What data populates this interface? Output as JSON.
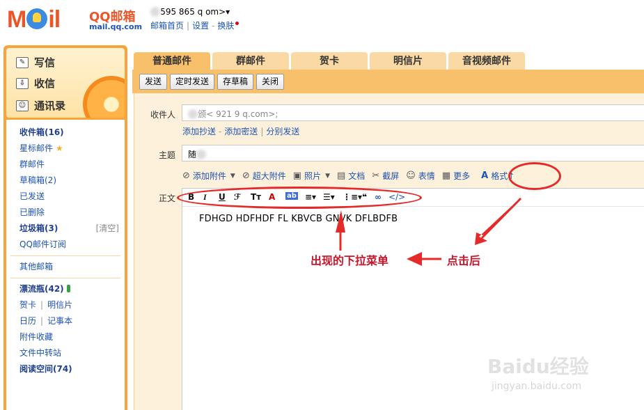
{
  "header": {
    "logo_main": "M  il",
    "logo_qq": "QQ邮箱",
    "logo_url": "mail.qq.com",
    "account": "595  865  q  om>▾",
    "nav": [
      "邮箱首页",
      "设置",
      "换肤"
    ]
  },
  "sidebar": {
    "actions": [
      {
        "label": "写信",
        "icon": "pencil-icon"
      },
      {
        "label": "收信",
        "icon": "inbox-download-icon"
      },
      {
        "label": "通讯录",
        "icon": "contacts-icon"
      }
    ],
    "folders": {
      "inbox": "收件箱(16)",
      "starred": "星标邮件",
      "group": "群邮件",
      "drafts": "草稿箱(2)",
      "sent": "已发送",
      "deleted": "已删除",
      "spam": "垃圾箱(3)",
      "clear": "[清空]",
      "subscribe": "QQ邮件订阅",
      "other": "其他邮箱",
      "drift": "漂流瓶(42)",
      "card": "贺卡",
      "postcard": "明信片",
      "calendar": "日历",
      "notes": "记事本",
      "attachments": "附件收藏",
      "transfer": "文件中转站",
      "reading": "阅读空间(74)"
    }
  },
  "tabs": [
    "普通邮件",
    "群邮件",
    "贺卡",
    "明信片",
    "音视频邮件"
  ],
  "toolbar": [
    "发送",
    "定时发送",
    "存草稿",
    "关闭"
  ],
  "compose": {
    "to_label": "收件人",
    "to_value": "<  921  9  q.com>;",
    "recipient_links": [
      "添加抄送",
      "添加密送",
      "分别发送"
    ],
    "subject_label": "主题",
    "subject_value": "随",
    "attachment_bar": [
      "添加附件",
      "超大附件",
      "照片",
      "文档",
      "截屏",
      "表情",
      "更多",
      "格式↑"
    ],
    "body_label": "正文",
    "body_text": "FDHGD  HDFHDF  FL  KBVCB  GNVK  DFLBDFB"
  },
  "annotations": {
    "dropdown_note": "出现的下拉菜单",
    "click_note": "点击后"
  },
  "watermark": {
    "brand": "Baidu经验",
    "url": "jingyan.baidu.com"
  },
  "colors": {
    "accent": "#f9c06b",
    "sidebar": "#f7a43a",
    "link": "#1d53b3",
    "annotation": "#e52a2a"
  }
}
